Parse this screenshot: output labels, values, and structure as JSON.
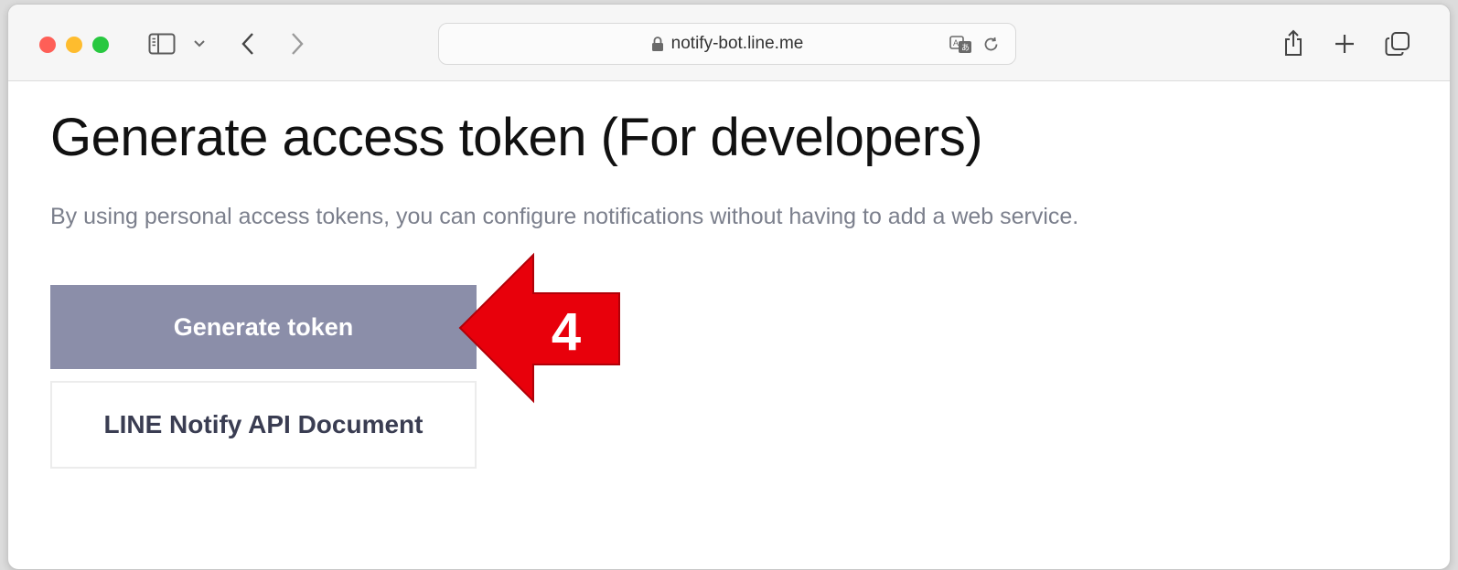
{
  "browser": {
    "url": "notify-bot.line.me"
  },
  "page": {
    "title": "Generate access token (For developers)",
    "description": "By using personal access tokens, you can configure notifications without having to add a web service.",
    "generate_button": "Generate token",
    "doc_button": "LINE Notify API Document"
  },
  "annotation": {
    "step_number": "4"
  },
  "icons": {
    "lock": "lock-icon",
    "translate": "translate-icon",
    "reload": "reload-icon",
    "share": "share-icon",
    "new_tab": "plus-icon",
    "tab_overview": "tabs-icon",
    "sidebar": "sidebar-icon",
    "back": "chevron-left-icon",
    "forward": "chevron-right-icon"
  },
  "colors": {
    "generate_button_bg": "#8b8ea9",
    "callout_red": "#e8000b",
    "traffic_red": "#fe5f57",
    "traffic_yellow": "#febc2e",
    "traffic_green": "#28c840"
  }
}
